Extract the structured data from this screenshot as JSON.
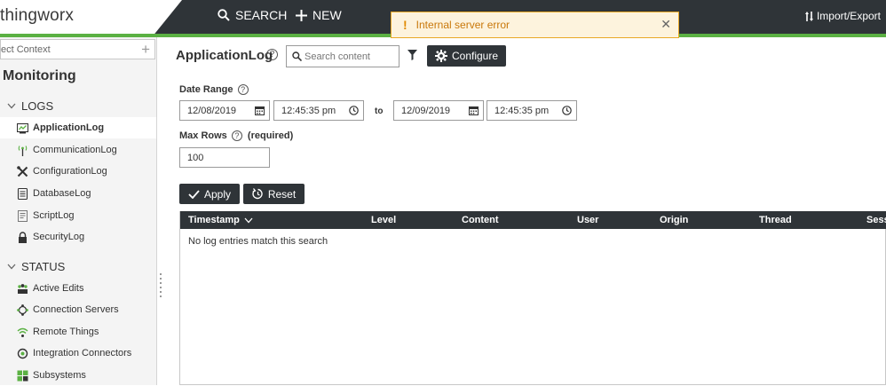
{
  "header": {
    "logo": "thingworx",
    "search_label": "SEARCH",
    "new_label": "NEW",
    "import_export_label": "Import/Export"
  },
  "toast": {
    "message": "Internal server error",
    "icon": "exclamation-icon",
    "color": "#e08a00"
  },
  "sidebar": {
    "context_placeholder": "ect Context",
    "section_title": "Monitoring",
    "groups": [
      {
        "label": "LOGS",
        "items": [
          {
            "label": "ApplicationLog",
            "icon": "application-log-icon",
            "active": true
          },
          {
            "label": "CommunicationLog",
            "icon": "antenna-icon"
          },
          {
            "label": "ConfigurationLog",
            "icon": "tools-icon"
          },
          {
            "label": "DatabaseLog",
            "icon": "database-icon"
          },
          {
            "label": "ScriptLog",
            "icon": "script-icon"
          },
          {
            "label": "SecurityLog",
            "icon": "lock-icon"
          }
        ]
      },
      {
        "label": "STATUS",
        "items": [
          {
            "label": "Active Edits",
            "icon": "users-icon"
          },
          {
            "label": "Connection Servers",
            "icon": "network-icon"
          },
          {
            "label": "Remote Things",
            "icon": "wifi-icon"
          },
          {
            "label": "Integration Connectors",
            "icon": "sync-icon"
          },
          {
            "label": "Subsystems",
            "icon": "grid-icon"
          }
        ]
      }
    ]
  },
  "main": {
    "title": "ApplicationLog",
    "search_placeholder": "Search content",
    "configure_label": "Configure",
    "date_range_label": "Date Range",
    "start_date": "12/08/2019",
    "start_time": "12:45:35 pm",
    "to_label": "to",
    "end_date": "12/09/2019",
    "end_time": "12:45:35 pm",
    "max_rows_label": "Max Rows",
    "max_rows_required": "(required)",
    "max_rows_value": "100",
    "apply_label": "Apply",
    "reset_label": "Reset"
  },
  "table": {
    "columns": [
      "Timestamp",
      "Level",
      "Content",
      "User",
      "Origin",
      "Thread",
      "Sess"
    ],
    "empty_message": "No log entries match this search"
  },
  "colors": {
    "topbar": "#2f3438",
    "accent_green": "#5bb143"
  }
}
